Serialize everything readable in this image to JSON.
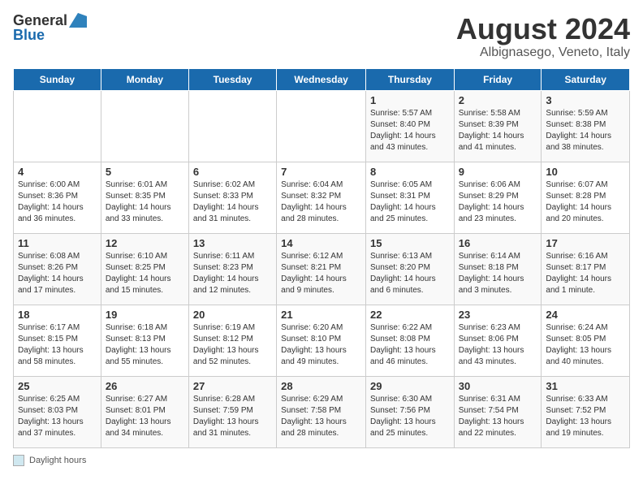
{
  "logo": {
    "general": "General",
    "blue": "Blue"
  },
  "title": "August 2024",
  "subtitle": "Albignasego, Veneto, Italy",
  "days_of_week": [
    "Sunday",
    "Monday",
    "Tuesday",
    "Wednesday",
    "Thursday",
    "Friday",
    "Saturday"
  ],
  "weeks": [
    [
      {
        "day": "",
        "info": ""
      },
      {
        "day": "",
        "info": ""
      },
      {
        "day": "",
        "info": ""
      },
      {
        "day": "",
        "info": ""
      },
      {
        "day": "1",
        "info": "Sunrise: 5:57 AM\nSunset: 8:40 PM\nDaylight: 14 hours and 43 minutes."
      },
      {
        "day": "2",
        "info": "Sunrise: 5:58 AM\nSunset: 8:39 PM\nDaylight: 14 hours and 41 minutes."
      },
      {
        "day": "3",
        "info": "Sunrise: 5:59 AM\nSunset: 8:38 PM\nDaylight: 14 hours and 38 minutes."
      }
    ],
    [
      {
        "day": "4",
        "info": "Sunrise: 6:00 AM\nSunset: 8:36 PM\nDaylight: 14 hours and 36 minutes."
      },
      {
        "day": "5",
        "info": "Sunrise: 6:01 AM\nSunset: 8:35 PM\nDaylight: 14 hours and 33 minutes."
      },
      {
        "day": "6",
        "info": "Sunrise: 6:02 AM\nSunset: 8:33 PM\nDaylight: 14 hours and 31 minutes."
      },
      {
        "day": "7",
        "info": "Sunrise: 6:04 AM\nSunset: 8:32 PM\nDaylight: 14 hours and 28 minutes."
      },
      {
        "day": "8",
        "info": "Sunrise: 6:05 AM\nSunset: 8:31 PM\nDaylight: 14 hours and 25 minutes."
      },
      {
        "day": "9",
        "info": "Sunrise: 6:06 AM\nSunset: 8:29 PM\nDaylight: 14 hours and 23 minutes."
      },
      {
        "day": "10",
        "info": "Sunrise: 6:07 AM\nSunset: 8:28 PM\nDaylight: 14 hours and 20 minutes."
      }
    ],
    [
      {
        "day": "11",
        "info": "Sunrise: 6:08 AM\nSunset: 8:26 PM\nDaylight: 14 hours and 17 minutes."
      },
      {
        "day": "12",
        "info": "Sunrise: 6:10 AM\nSunset: 8:25 PM\nDaylight: 14 hours and 15 minutes."
      },
      {
        "day": "13",
        "info": "Sunrise: 6:11 AM\nSunset: 8:23 PM\nDaylight: 14 hours and 12 minutes."
      },
      {
        "day": "14",
        "info": "Sunrise: 6:12 AM\nSunset: 8:21 PM\nDaylight: 14 hours and 9 minutes."
      },
      {
        "day": "15",
        "info": "Sunrise: 6:13 AM\nSunset: 8:20 PM\nDaylight: 14 hours and 6 minutes."
      },
      {
        "day": "16",
        "info": "Sunrise: 6:14 AM\nSunset: 8:18 PM\nDaylight: 14 hours and 3 minutes."
      },
      {
        "day": "17",
        "info": "Sunrise: 6:16 AM\nSunset: 8:17 PM\nDaylight: 14 hours and 1 minute."
      }
    ],
    [
      {
        "day": "18",
        "info": "Sunrise: 6:17 AM\nSunset: 8:15 PM\nDaylight: 13 hours and 58 minutes."
      },
      {
        "day": "19",
        "info": "Sunrise: 6:18 AM\nSunset: 8:13 PM\nDaylight: 13 hours and 55 minutes."
      },
      {
        "day": "20",
        "info": "Sunrise: 6:19 AM\nSunset: 8:12 PM\nDaylight: 13 hours and 52 minutes."
      },
      {
        "day": "21",
        "info": "Sunrise: 6:20 AM\nSunset: 8:10 PM\nDaylight: 13 hours and 49 minutes."
      },
      {
        "day": "22",
        "info": "Sunrise: 6:22 AM\nSunset: 8:08 PM\nDaylight: 13 hours and 46 minutes."
      },
      {
        "day": "23",
        "info": "Sunrise: 6:23 AM\nSunset: 8:06 PM\nDaylight: 13 hours and 43 minutes."
      },
      {
        "day": "24",
        "info": "Sunrise: 6:24 AM\nSunset: 8:05 PM\nDaylight: 13 hours and 40 minutes."
      }
    ],
    [
      {
        "day": "25",
        "info": "Sunrise: 6:25 AM\nSunset: 8:03 PM\nDaylight: 13 hours and 37 minutes."
      },
      {
        "day": "26",
        "info": "Sunrise: 6:27 AM\nSunset: 8:01 PM\nDaylight: 13 hours and 34 minutes."
      },
      {
        "day": "27",
        "info": "Sunrise: 6:28 AM\nSunset: 7:59 PM\nDaylight: 13 hours and 31 minutes."
      },
      {
        "day": "28",
        "info": "Sunrise: 6:29 AM\nSunset: 7:58 PM\nDaylight: 13 hours and 28 minutes."
      },
      {
        "day": "29",
        "info": "Sunrise: 6:30 AM\nSunset: 7:56 PM\nDaylight: 13 hours and 25 minutes."
      },
      {
        "day": "30",
        "info": "Sunrise: 6:31 AM\nSunset: 7:54 PM\nDaylight: 13 hours and 22 minutes."
      },
      {
        "day": "31",
        "info": "Sunrise: 6:33 AM\nSunset: 7:52 PM\nDaylight: 13 hours and 19 minutes."
      }
    ]
  ],
  "footer": {
    "box_label": "Daylight hours"
  }
}
